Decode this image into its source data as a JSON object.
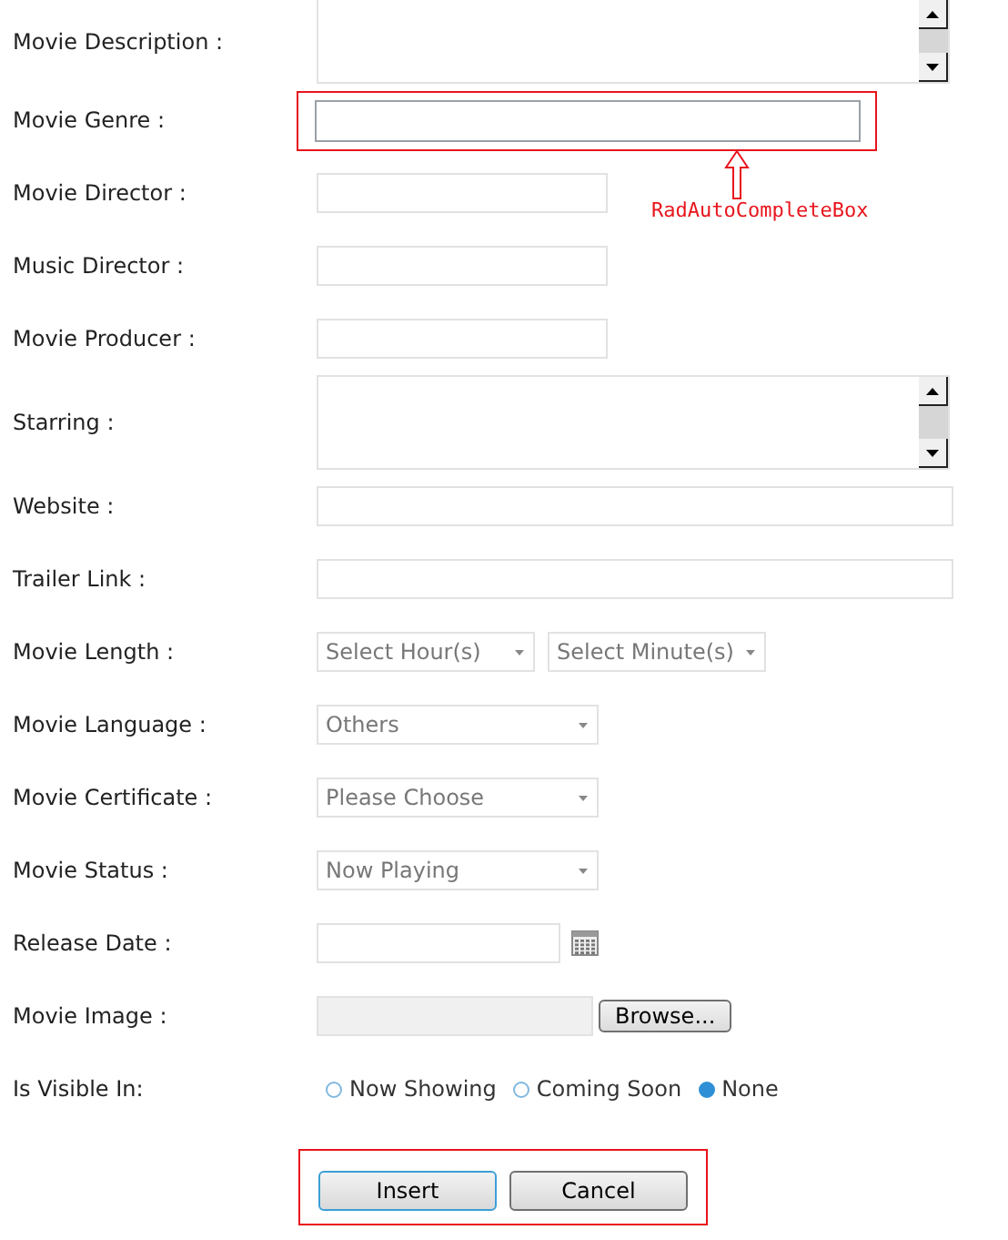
{
  "fields": [
    {
      "label": "Movie Description :",
      "kind": "textarea"
    },
    {
      "label": "Movie Genre :",
      "kind": "autocomplete",
      "highlighted": true
    },
    {
      "label": "Movie Director :",
      "kind": "text"
    },
    {
      "label": "Music Director :",
      "kind": "text"
    },
    {
      "label": "Movie Producer :",
      "kind": "text"
    },
    {
      "label": "Starring :",
      "kind": "textarea"
    },
    {
      "label": "Website :",
      "kind": "wide_text"
    },
    {
      "label": "Trailer Link :",
      "kind": "wide_text"
    },
    {
      "label": "Movie Length :",
      "kind": "dropdowns",
      "options": [
        "Select Hour(s)",
        "Select Minute(s)"
      ]
    },
    {
      "label": "Movie Language :",
      "kind": "dropdowns",
      "options": [
        "Others"
      ]
    },
    {
      "label": "Movie Certificate :",
      "kind": "dropdowns",
      "options": [
        "Please Choose"
      ]
    },
    {
      "label": "Movie Status :",
      "kind": "dropdowns",
      "options": [
        "Now Playing"
      ]
    },
    {
      "label": "Release Date :",
      "kind": "date"
    },
    {
      "label": "Movie Image :",
      "kind": "file",
      "button": "Browse..."
    },
    {
      "label": "Is Visible In:",
      "kind": "radio",
      "options": [
        {
          "label": "Now Showing",
          "selected": false
        },
        {
          "label": "Coming Soon",
          "selected": false
        },
        {
          "label": "None",
          "selected": true
        }
      ]
    }
  ],
  "buttons": [
    "Insert",
    "Cancel"
  ],
  "buttons_highlighted": true,
  "annotation": "RadAutoCompleteBox"
}
